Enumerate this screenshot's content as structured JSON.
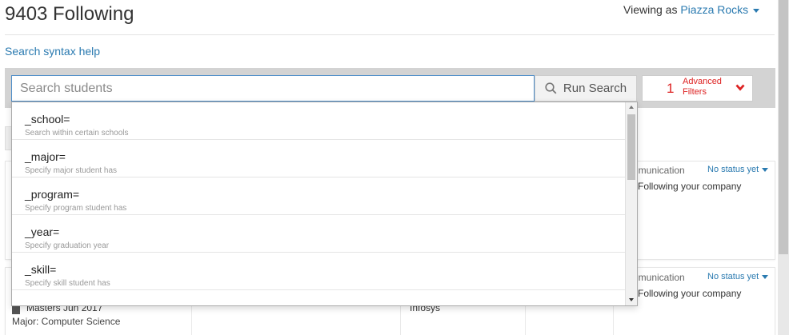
{
  "header": {
    "title": "9403 Following",
    "viewing_prefix": "Viewing as",
    "viewing_user": "Piazza Rocks"
  },
  "search_help_link": "Search syntax help",
  "search": {
    "placeholder": "Search students",
    "value": "",
    "run_label": "Run Search",
    "advanced_count": "1",
    "advanced_label_line1": "Advanced",
    "advanced_label_line2": "Filters"
  },
  "autocomplete": [
    {
      "title": "_school=",
      "description": "Search within certain schools"
    },
    {
      "title": "_major=",
      "description": "Specify major student has"
    },
    {
      "title": "_program=",
      "description": "Specify program student has"
    },
    {
      "title": "_year=",
      "description": "Specify graduation year"
    },
    {
      "title": "_skill=",
      "description": "Specify skill student has"
    }
  ],
  "results": [
    {
      "channel_fragment": "nmunication",
      "status": "No status yet",
      "following_text": "Following your company"
    },
    {
      "channel_fragment": "nmunication",
      "status": "No status yet",
      "following_text": "Following your company",
      "degree": "Masters Jun 2017",
      "major": "Major: Computer Science",
      "company": "Infosys"
    }
  ],
  "colors": {
    "link": "#2a7ab0",
    "advanced": "#dd2222",
    "search_bar_bg": "#d3d3d3"
  },
  "icons": {
    "run_search": "magnifier-icon",
    "advanced_toggle": "chevron-down-icon",
    "viewing_dropdown": "caret-down-icon"
  }
}
